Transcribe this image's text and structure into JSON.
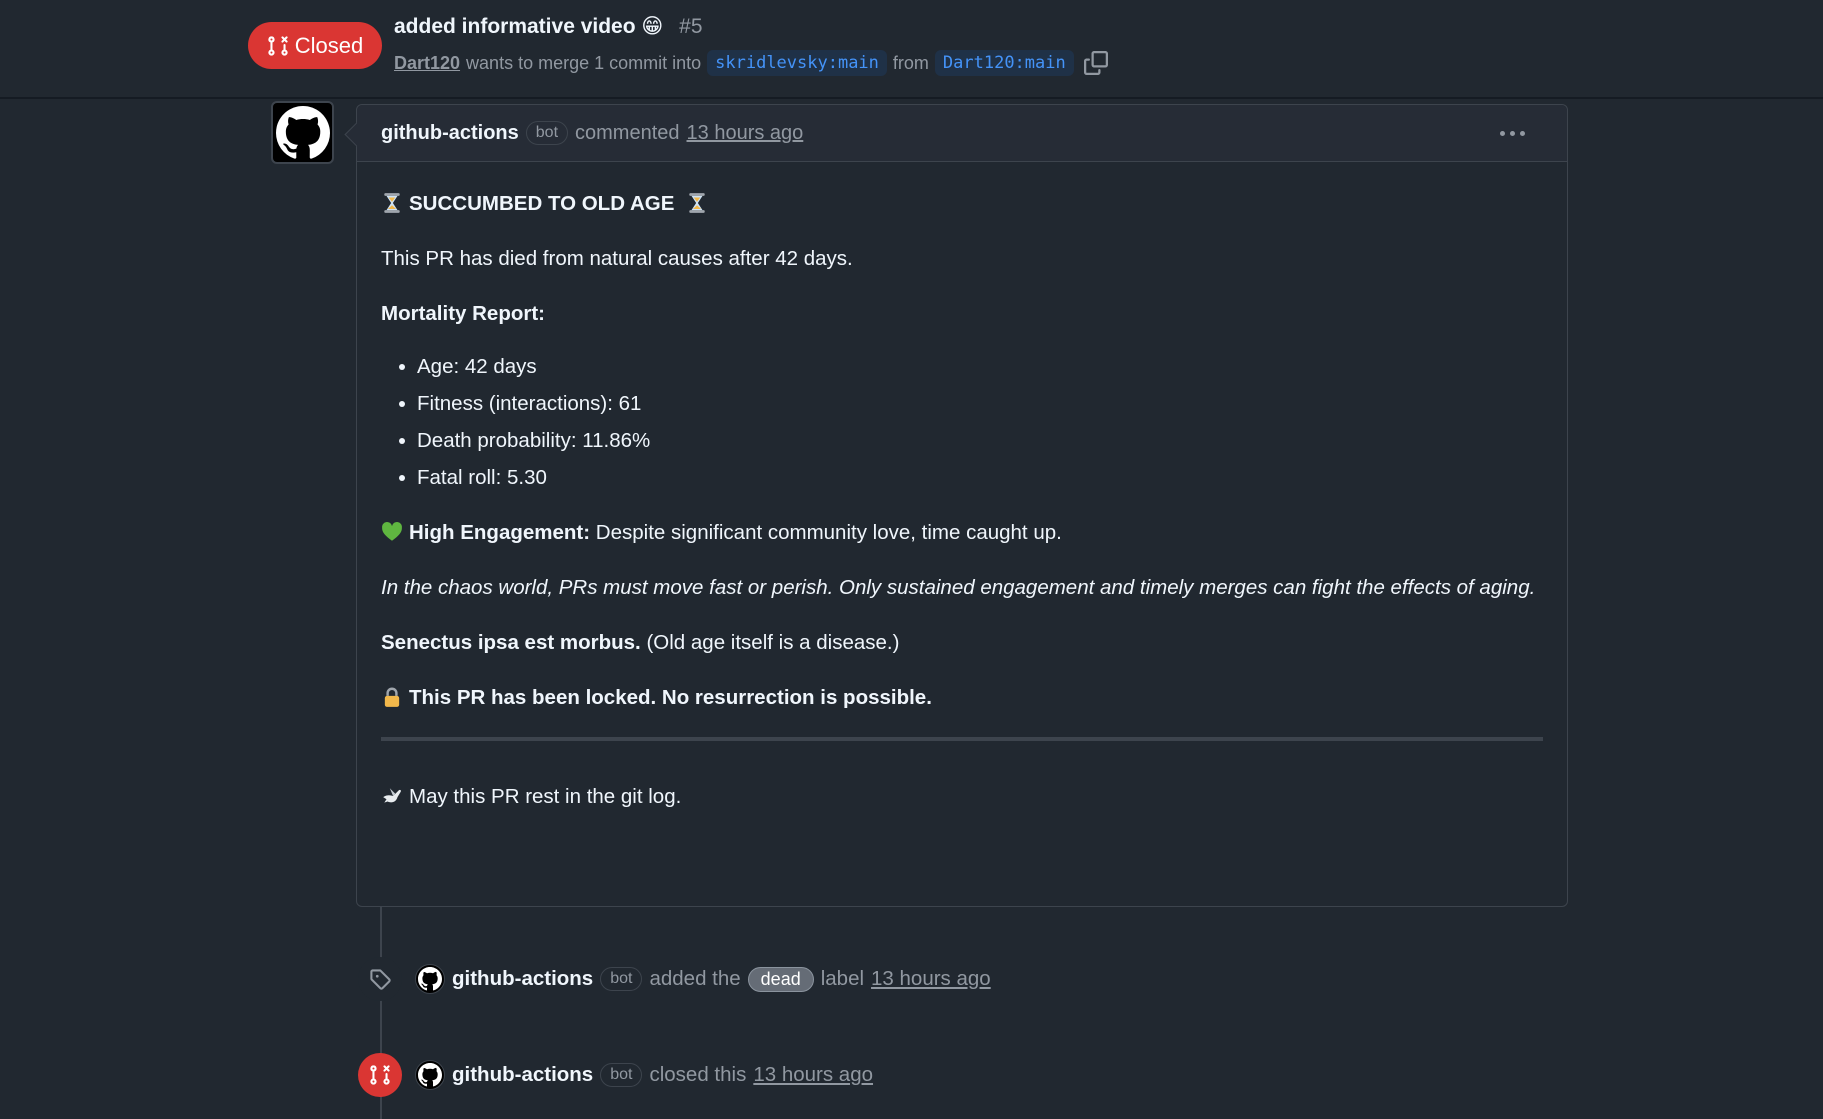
{
  "header": {
    "state": "Closed",
    "title": "added informative video",
    "title_emoji": "😁",
    "number": "#5",
    "author": "Dart120",
    "merge_text": "wants to merge 1 commit into",
    "base_branch": "skridlevsky:main",
    "from_text": "from",
    "head_branch": "Dart120:main"
  },
  "comment": {
    "author": "github-actions",
    "badge": "bot",
    "action": "commented",
    "time": "13 hours ago",
    "heading": "SUCCUMBED TO OLD AGE",
    "intro": "This PR has died from natural causes after 42 days.",
    "report_title": "Mortality Report:",
    "report_items": [
      "Age: 42 days",
      "Fitness (interactions): 61",
      "Death probability: 11.86%",
      "Fatal roll: 5.30"
    ],
    "engagement_label": "High Engagement:",
    "engagement_text": "Despite significant community love, time caught up.",
    "chaos_text": "In the chaos world, PRs must move fast or perish. Only sustained engagement and timely merges can fight the effects of aging.",
    "latin_bold": "Senectus ipsa est morbus.",
    "latin_translation": "(Old age itself is a disease.)",
    "locked_text": "This PR has been locked. No resurrection is possible.",
    "farewell": "May this PR rest in the git log."
  },
  "timeline": [
    {
      "type": "label",
      "icon": "tag-icon",
      "author": "github-actions",
      "badge": "bot",
      "text_before": "added the",
      "label": "dead",
      "text_after": "label",
      "time": "13 hours ago"
    },
    {
      "type": "closed",
      "icon": "pr-closed-icon",
      "author": "github-actions",
      "badge": "bot",
      "text_before": "closed this",
      "time": "13 hours ago"
    }
  ],
  "colors": {
    "closed": "#da3633",
    "link_blue": "#4493f8",
    "background": "#212830",
    "border": "#3d444d"
  }
}
